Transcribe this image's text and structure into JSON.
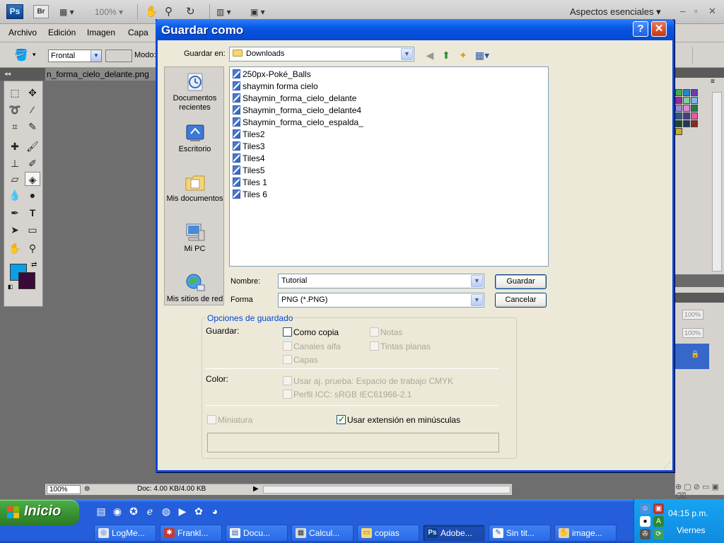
{
  "photoshop": {
    "logo_ps": "Ps",
    "logo_br": "Br",
    "zoom_select": "100%",
    "workspace": "Aspectos esenciales",
    "menus": [
      "Archivo",
      "Edición",
      "Imagen",
      "Capa"
    ],
    "options": {
      "mode_select": "Frontal",
      "mode_label": "Modo:"
    },
    "doc_tab": "n_forma_cielo_delante.png",
    "status": {
      "zoom": "100%",
      "doc_info": "Doc: 4.00 KB/4.00 KB"
    },
    "right_panel": {
      "pct_1": "100%",
      "pct_2": "100%"
    },
    "colors": {
      "foreground": "#0aa0e6",
      "background": "#3a0a3a"
    }
  },
  "dialog": {
    "title": "Guardar como",
    "save_in_label": "Guardar en:",
    "save_in_value": "Downloads",
    "places": [
      {
        "label_1": "Documentos",
        "label_2": "recientes"
      },
      {
        "label_1": "Escritorio",
        "label_2": ""
      },
      {
        "label_1": "Mis documentos",
        "label_2": ""
      },
      {
        "label_1": "Mi PC",
        "label_2": ""
      },
      {
        "label_1": "Mis sitios de red",
        "label_2": ""
      }
    ],
    "files": [
      "250px-Poké_Balls",
      "shaymin forma cielo",
      "Shaymin_forma_cielo_delante",
      "Shaymin_forma_cielo_delante4",
      "Shaymin_forma_cielo_espalda_",
      "Tiles2",
      "Tiles3",
      "Tiles4",
      "Tiles5",
      "Tiles 1",
      "Tiles 6"
    ],
    "name_label": "Nombre:",
    "name_value": "Tutorial",
    "format_label": "Forma",
    "format_value": "PNG (*.PNG)",
    "save_button": "Guardar",
    "cancel_button": "Cancelar",
    "options": {
      "group_title": "Opciones de guardado",
      "save_label": "Guardar:",
      "como_copia": "Como copia",
      "notas": "Notas",
      "canales_alfa": "Canales alfa",
      "tintas_planas": "Tintas planas",
      "capas": "Capas",
      "color_label": "Color:",
      "usar_prueba": "Usar aj. prueba: Espacio de trabajo CMYK",
      "perfil_icc": "Perfil ICC: sRGB IEC61966-2.1",
      "miniatura": "Miniatura",
      "usar_extension": "Usar extensión en minúsculas"
    }
  },
  "taskbar": {
    "start_label": "Inicio",
    "tasks": [
      "LogMe...",
      "Frankl...",
      "Docu...",
      "Calcul...",
      "copias",
      "Adobe...",
      "Sin tit...",
      "image..."
    ],
    "clock": "04:15 p.m.",
    "day": "Viernes"
  }
}
